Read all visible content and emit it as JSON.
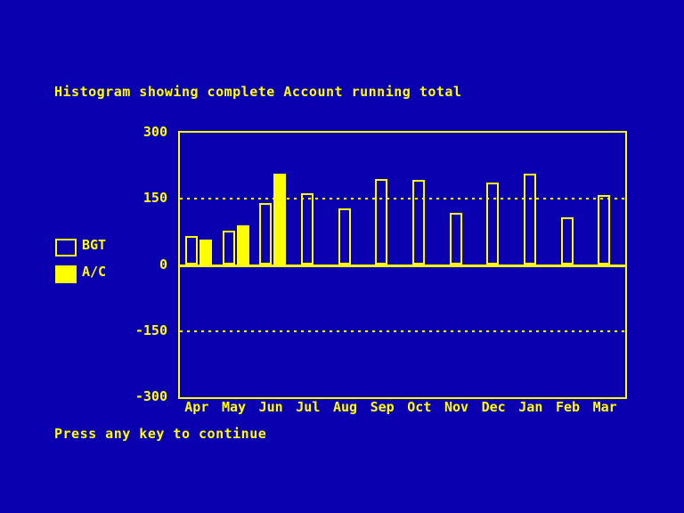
{
  "screen": {
    "background_color": "#0a00b0",
    "foreground_color": "#ffff00"
  },
  "title": "Histogram showing complete Account running total",
  "footer": "Press any key to continue",
  "legend": {
    "items": [
      {
        "label": "BGT",
        "style": "hollow",
        "color": "#ffff00"
      },
      {
        "label": "A/C",
        "style": "solid",
        "color": "#ffff00"
      }
    ]
  },
  "chart_data": {
    "type": "bar",
    "title": "Histogram showing complete Account running total",
    "xlabel": "",
    "ylabel": "",
    "ylim": [
      -300,
      300
    ],
    "yticks": [
      300,
      150,
      0,
      -150,
      -300
    ],
    "gridlines": [
      150,
      -150
    ],
    "grid": true,
    "legend_position": "left",
    "categories": [
      "Apr",
      "May",
      "Jun",
      "Jul",
      "Aug",
      "Sep",
      "Oct",
      "Nov",
      "Dec",
      "Jan",
      "Feb",
      "Mar"
    ],
    "series": [
      {
        "name": "BGT",
        "style": "hollow",
        "values": [
          66,
          77,
          140,
          163,
          128,
          194,
          192,
          119,
          186,
          208,
          108,
          158
        ]
      },
      {
        "name": "A/C",
        "style": "solid",
        "values": [
          58,
          90,
          208,
          null,
          null,
          null,
          null,
          null,
          null,
          null,
          null,
          null
        ]
      }
    ]
  }
}
